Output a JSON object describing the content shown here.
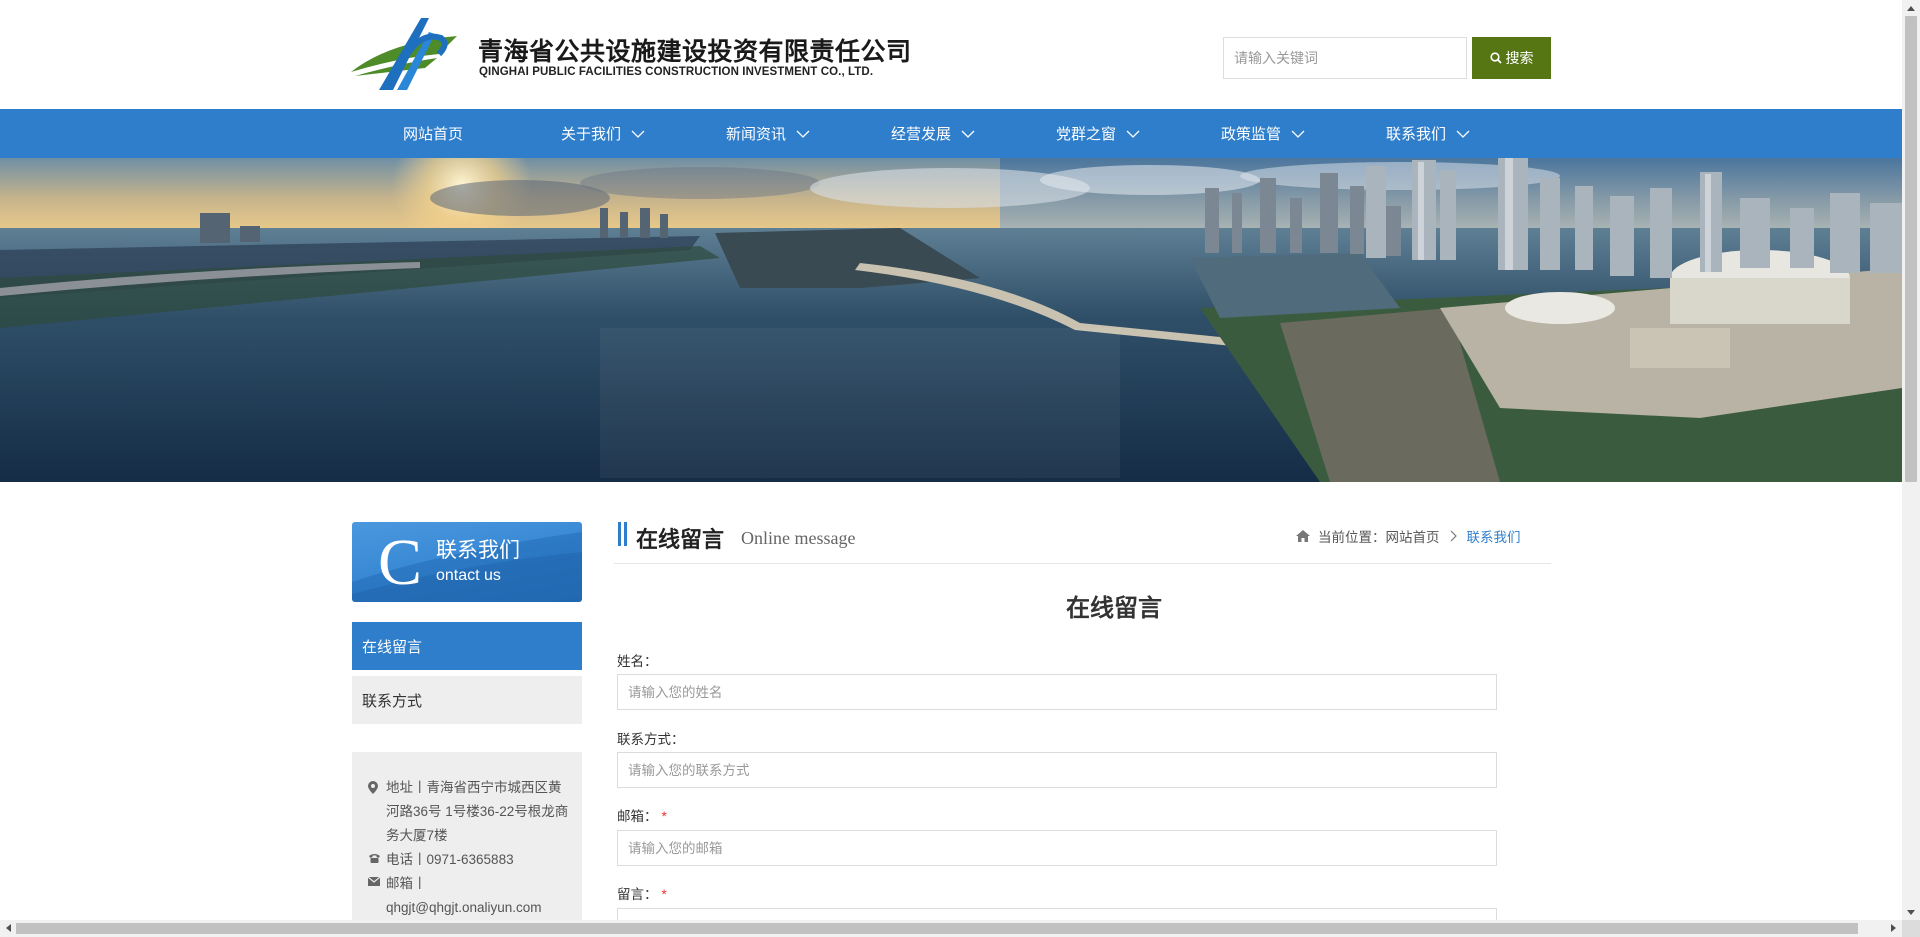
{
  "header": {
    "company_cn": "青海省公共设施建设投资有限责任公司",
    "company_en": "QINGHAI PUBLIC FACILITIES CONSTRUCTION INVESTMENT CO., LTD.",
    "search_placeholder": "请输入关键词",
    "search_label": "搜索",
    "colors": {
      "search_button": "#567614",
      "logo_green": "#4e8c2a",
      "logo_blue": "#1f6fbf"
    }
  },
  "nav": {
    "color": "#2f7ecb",
    "items": [
      {
        "label": "网站首页",
        "has_dropdown": false
      },
      {
        "label": "关于我们",
        "has_dropdown": true
      },
      {
        "label": "新闻资讯",
        "has_dropdown": true
      },
      {
        "label": "经营发展",
        "has_dropdown": true
      },
      {
        "label": "党群之窗",
        "has_dropdown": true
      },
      {
        "label": "政策监管",
        "has_dropdown": true
      },
      {
        "label": "联系我们",
        "has_dropdown": true
      }
    ]
  },
  "sidebar": {
    "header_letter": "C",
    "header_cn": "联系我们",
    "header_en": "ontact us",
    "items": [
      {
        "label": "在线留言",
        "active": true
      },
      {
        "label": "联系方式",
        "active": false
      }
    ],
    "contact": {
      "address": "地址丨青海省西宁市城西区黄河路36号 1号楼36-22号根龙商务大厦7楼",
      "phone": "电话丨0971-6365883",
      "email_label": "邮箱丨",
      "email": "qhgjt@qhgjt.onaliyun.com"
    }
  },
  "main": {
    "title": "在线留言",
    "subtitle": "Online message",
    "breadcrumb": {
      "prefix": "当前位置：",
      "home": "网站首页",
      "current": "联系我们"
    },
    "form": {
      "title": "在线留言",
      "fields": [
        {
          "label": "姓名：",
          "placeholder": "请输入您的姓名",
          "required": false
        },
        {
          "label": "联系方式：",
          "placeholder": "请输入您的联系方式",
          "required": false
        },
        {
          "label": "邮箱：",
          "placeholder": "请输入您的邮箱",
          "required": true
        },
        {
          "label": "留言：",
          "placeholder": "",
          "required": true
        }
      ],
      "required_mark": "*"
    }
  }
}
